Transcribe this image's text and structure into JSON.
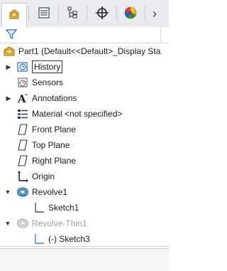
{
  "tabs": [
    {
      "icon": "feature-manager-icon"
    },
    {
      "icon": "property-manager-icon"
    },
    {
      "icon": "configuration-manager-icon"
    },
    {
      "icon": "dimxpert-manager-icon"
    },
    {
      "icon": "display-manager-icon"
    }
  ],
  "tabs_more": "›",
  "colors": {
    "accent": "#e6a21a",
    "selection_border": "#333333",
    "icon_blue": "#2a6fb7"
  },
  "tree": {
    "root": "Part1  (Default<<Default>_Display Sta",
    "items": [
      {
        "label": "History",
        "icon": "history-icon",
        "expandable": true
      },
      {
        "label": "Sensors",
        "icon": "sensors-icon",
        "expandable": false
      },
      {
        "label": "Annotations",
        "icon": "annotations-icon",
        "expandable": true
      },
      {
        "label": "Material <not specified>",
        "icon": "material-icon",
        "expandable": false
      },
      {
        "label": "Front Plane",
        "icon": "plane-icon",
        "expandable": false
      },
      {
        "label": "Top Plane",
        "icon": "plane-icon",
        "expandable": false
      },
      {
        "label": "Right Plane",
        "icon": "plane-icon",
        "expandable": false
      },
      {
        "label": "Origin",
        "icon": "origin-icon",
        "expandable": false
      },
      {
        "label": "Revolve1",
        "icon": "revolve-icon",
        "expandable": true
      },
      {
        "label": "Sketch1",
        "icon": "sketch-icon",
        "expandable": false
      },
      {
        "label": "Revolve-Thin1",
        "icon": "revolve-thin-icon",
        "expandable": true
      },
      {
        "label": "(-) Sketch3",
        "icon": "sketch-icon",
        "expandable": false
      }
    ]
  }
}
